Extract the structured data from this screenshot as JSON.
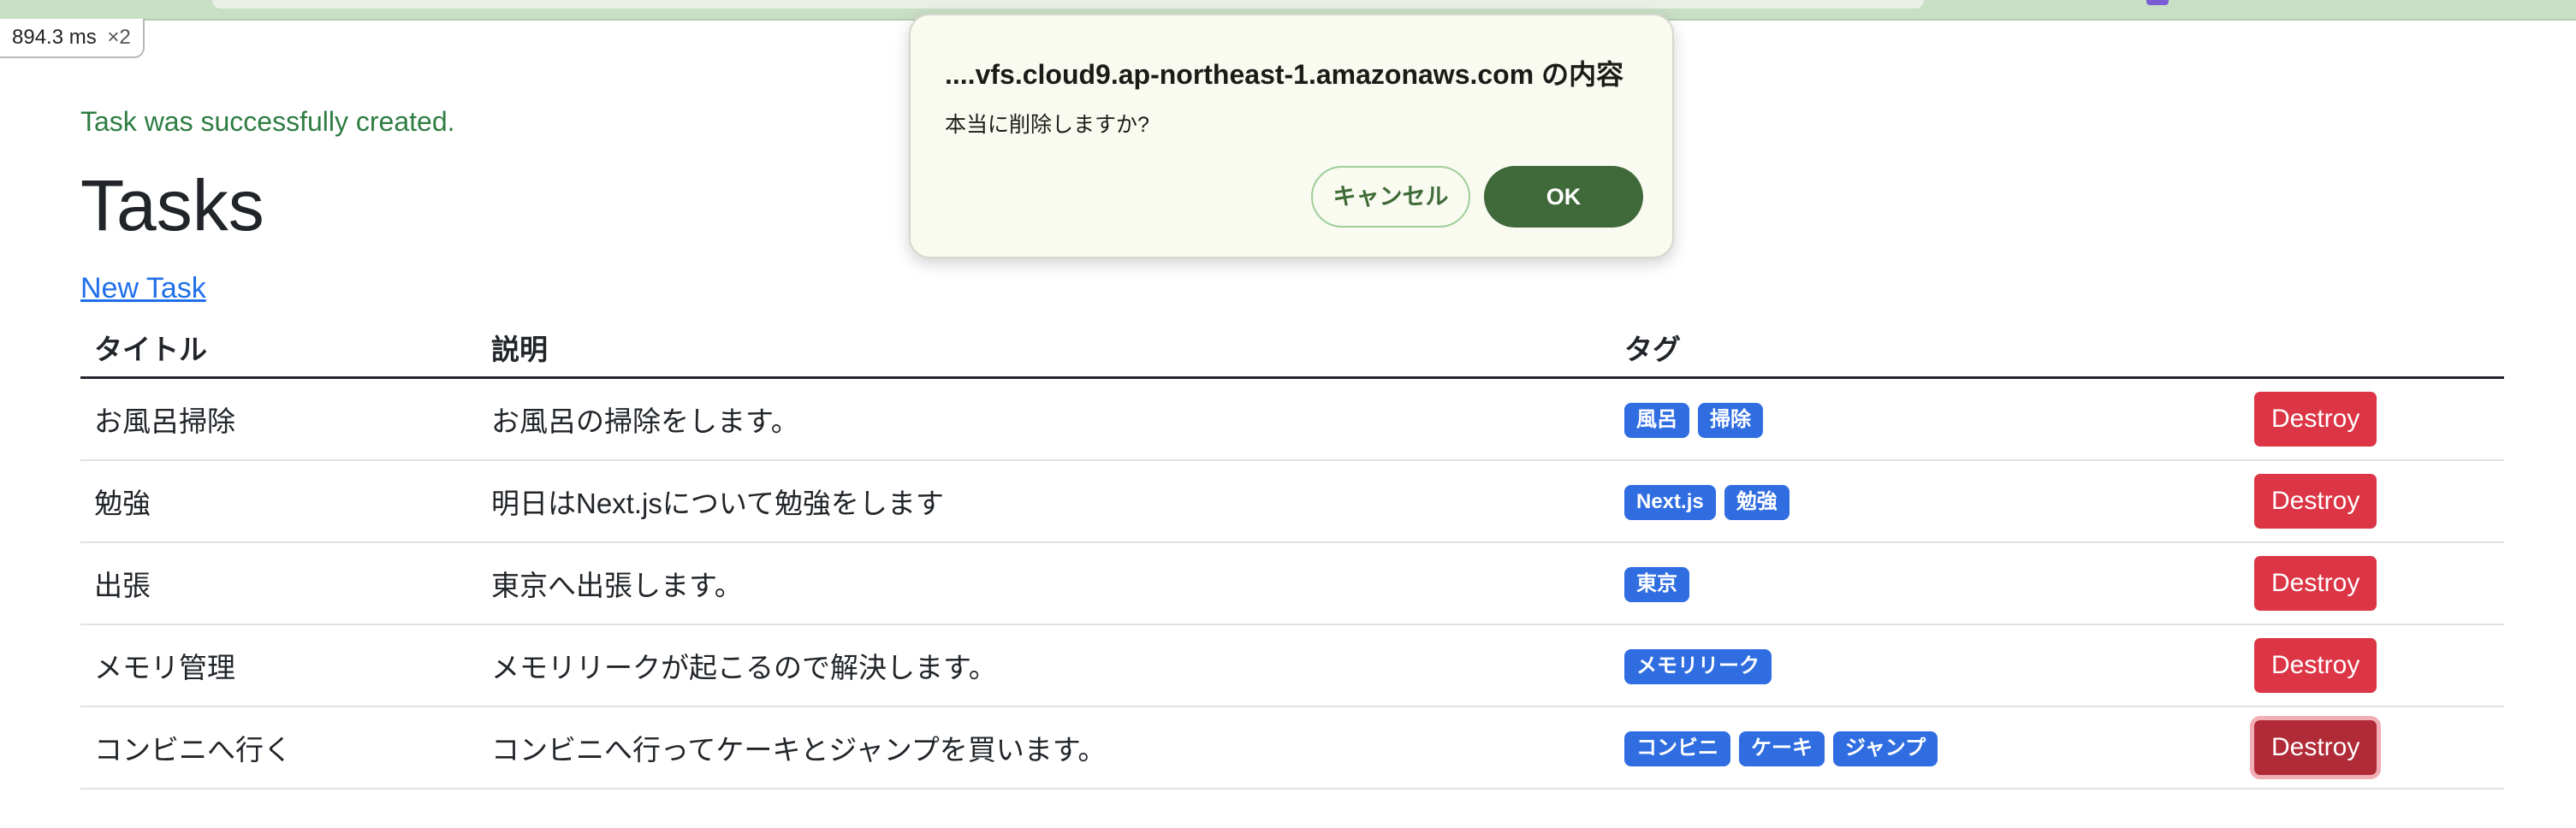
{
  "perf": {
    "value": "894.3",
    "unit": "ms",
    "multiplier": "×2"
  },
  "flash": "Task was successfully created.",
  "heading": "Tasks",
  "new_task_link": "New Task",
  "table": {
    "headers": [
      "タイトル",
      "説明",
      "タグ",
      ""
    ],
    "rows": [
      {
        "title": "お風呂掃除",
        "description": "お風呂の掃除をします。",
        "tags": [
          "風呂",
          "掃除"
        ],
        "action": "Destroy"
      },
      {
        "title": "勉強",
        "description": "明日はNext.jsについて勉強をします",
        "tags": [
          "Next.js",
          "勉強"
        ],
        "action": "Destroy"
      },
      {
        "title": "出張",
        "description": "東京へ出張します。",
        "tags": [
          "東京"
        ],
        "action": "Destroy"
      },
      {
        "title": "メモリ管理",
        "description": "メモリリークが起こるので解決します。",
        "tags": [
          "メモリリーク"
        ],
        "action": "Destroy"
      },
      {
        "title": "コンビニへ行く",
        "description": "コンビニへ行ってケーキとジャンプを買います。",
        "tags": [
          "コンビニ",
          "ケーキ",
          "ジャンプ"
        ],
        "action": "Destroy"
      }
    ]
  },
  "dialog": {
    "title": "....vfs.cloud9.ap-northeast-1.amazonaws.com の内容",
    "message": "本当に削除しますか?",
    "cancel_label": "キャンセル",
    "ok_label": "OK"
  },
  "colors": {
    "flash_text": "#2e7d43",
    "link": "#1f6feb",
    "tag_badge": "#2f6de1",
    "destroy_button": "#dc3545",
    "dialog_ok": "#40693a"
  }
}
